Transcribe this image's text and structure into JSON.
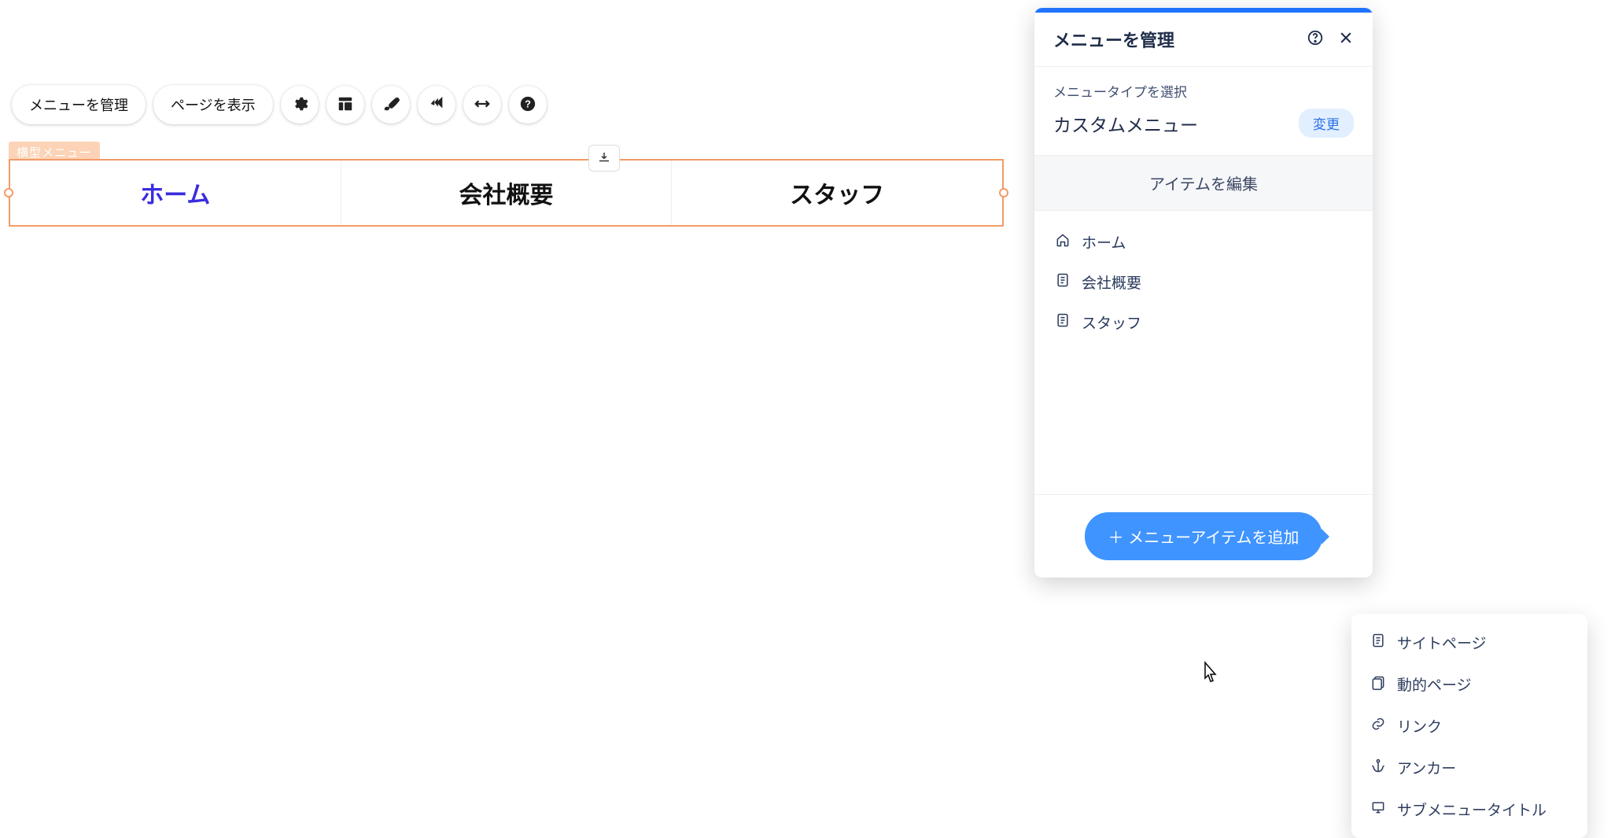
{
  "toolbar": {
    "manage_menu_label": "メニューを管理",
    "show_pages_label": "ページを表示"
  },
  "menu_tag": "横型メニュー",
  "hmenu": {
    "items": [
      {
        "label": "ホーム",
        "active": true
      },
      {
        "label": "会社概要",
        "active": false
      },
      {
        "label": "スタッフ",
        "active": false
      }
    ]
  },
  "panel": {
    "title": "メニューを管理",
    "type_section_label": "メニュータイプを選択",
    "type_value": "カスタムメニュー",
    "change_label": "変更",
    "subhead": "アイテムを編集",
    "items": [
      {
        "label": "ホーム",
        "icon": "home"
      },
      {
        "label": "会社概要",
        "icon": "page"
      },
      {
        "label": "スタッフ",
        "icon": "page"
      }
    ],
    "add_button_label": "＋ メニューアイテムを追加"
  },
  "popover": {
    "items": [
      {
        "label": "サイトページ",
        "icon": "page"
      },
      {
        "label": "動的ページ",
        "icon": "dynamic"
      },
      {
        "label": "リンク",
        "icon": "link"
      },
      {
        "label": "アンカー",
        "icon": "anchor"
      },
      {
        "label": "サブメニュータイトル",
        "icon": "subtitle"
      }
    ]
  }
}
